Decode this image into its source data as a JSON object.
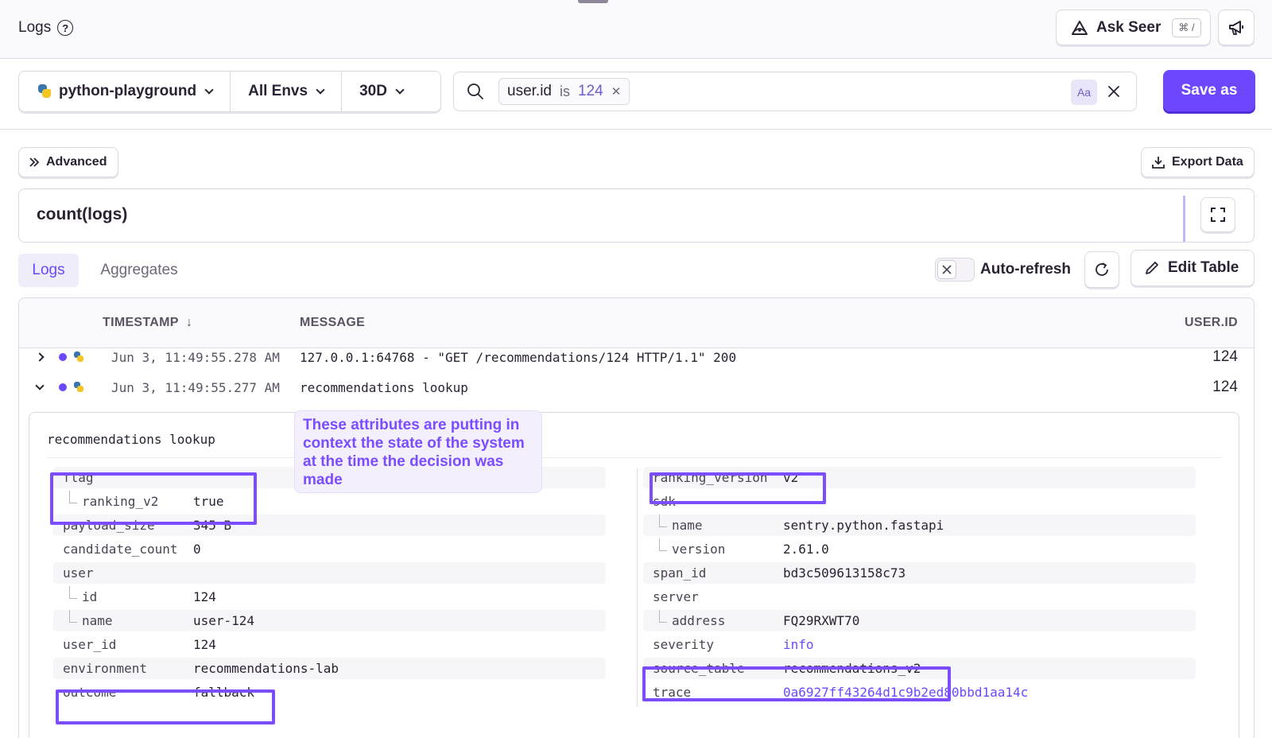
{
  "header": {
    "title": "Logs",
    "ask_seer": {
      "label": "Ask Seer",
      "shortcut": "⌘ /"
    }
  },
  "filters": {
    "project": "python-playground",
    "environment": "All Envs",
    "period": "30D"
  },
  "search": {
    "token_key": "user.id",
    "token_op": "is",
    "token_value": "124",
    "case_label": "Aa"
  },
  "save_as": "Save as",
  "toolbar": {
    "advanced": "Advanced",
    "export": "Export Data"
  },
  "chart": {
    "title": "count(logs)"
  },
  "tabs": {
    "logs": "Logs",
    "aggregates": "Aggregates"
  },
  "auto_refresh": "Auto-refresh",
  "edit_table": "Edit Table",
  "table": {
    "columns": {
      "timestamp": "TIMESTAMP",
      "message": "MESSAGE",
      "user_id": "USER.ID"
    },
    "rows": [
      {
        "timestamp": "Jun 3, 11:49:55.278 AM",
        "message": "127.0.0.1:64768 - \"GET /recommendations/124 HTTP/1.1\" 200",
        "user_id": "124"
      },
      {
        "timestamp": "Jun 3, 11:49:55.277 AM",
        "message": "recommendations lookup",
        "user_id": "124"
      }
    ]
  },
  "detail": {
    "title": "recommendations lookup",
    "left": [
      {
        "key": "flag",
        "value": ""
      },
      {
        "key": "ranking_v2",
        "value": "true"
      },
      {
        "key": "payload_size",
        "value": "345 B"
      },
      {
        "key": "candidate_count",
        "value": "0"
      },
      {
        "key": "user",
        "value": ""
      },
      {
        "key": "id",
        "value": "124"
      },
      {
        "key": "name",
        "value": "user-124"
      },
      {
        "key": "user_id",
        "value": "124"
      },
      {
        "key": "environment",
        "value": "recommendations-lab"
      },
      {
        "key": "outcome",
        "value": "fallback"
      }
    ],
    "right": [
      {
        "key": "ranking_version",
        "value": "v2"
      },
      {
        "key": "sdk",
        "value": ""
      },
      {
        "key": "name",
        "value": "sentry.python.fastapi"
      },
      {
        "key": "version",
        "value": "2.61.0"
      },
      {
        "key": "span_id",
        "value": "bd3c509613158c73"
      },
      {
        "key": "server",
        "value": ""
      },
      {
        "key": "address",
        "value": "FQ29RXWT70"
      },
      {
        "key": "severity",
        "value": "info"
      },
      {
        "key": "source_table",
        "value": "recommendations_v2"
      },
      {
        "key": "trace",
        "value": "0a6927ff43264d1c9b2ed80bbd1aa14c"
      }
    ]
  },
  "callout": "These attributes are putting in context the state of the system at the time the decision was made",
  "colors": {
    "accent": "#6c47ff",
    "highlight": "#7b4dff"
  }
}
